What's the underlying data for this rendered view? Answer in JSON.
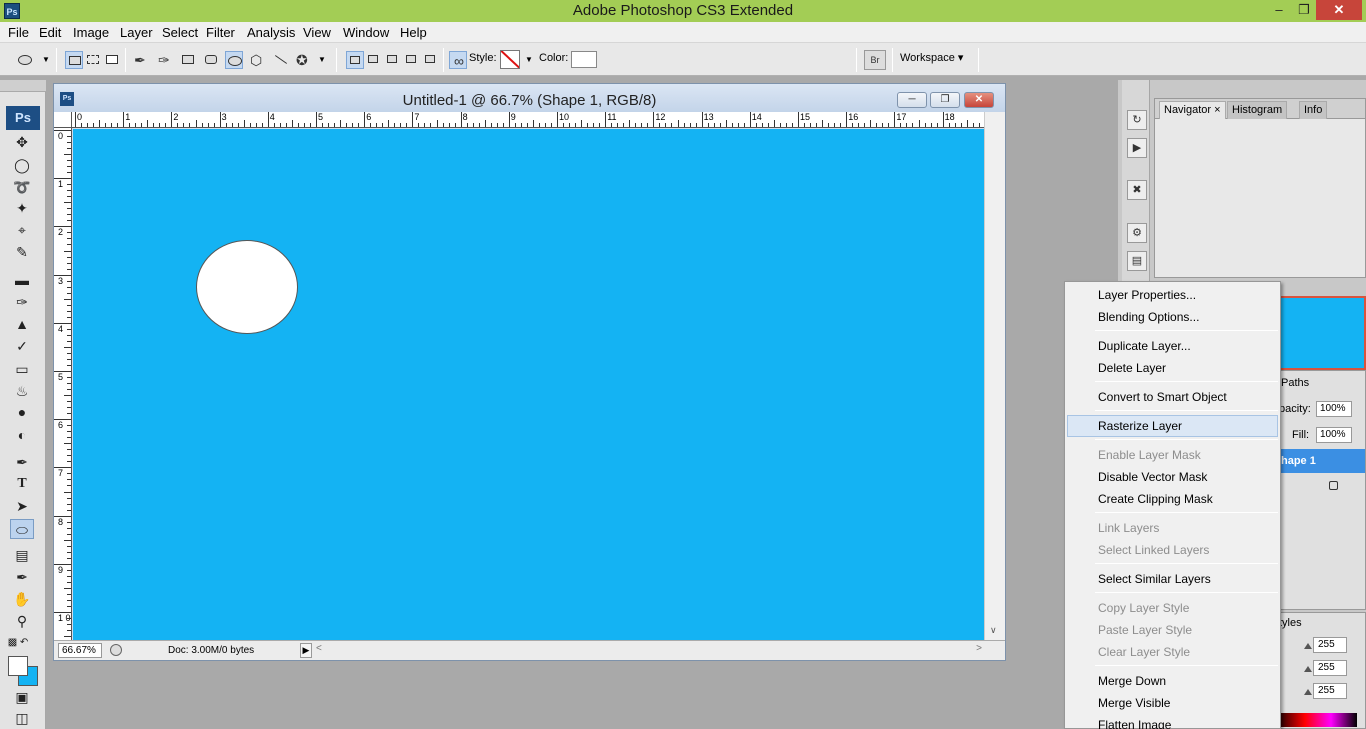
{
  "app": {
    "icon_label": "Ps",
    "title": "Adobe Photoshop CS3 Extended"
  },
  "window_controls": {
    "minimize": "–",
    "maximize": "❐",
    "close": "✕"
  },
  "menubar": [
    "File",
    "Edit",
    "Image",
    "Layer",
    "Select",
    "Filter",
    "Analysis",
    "View",
    "Window",
    "Help"
  ],
  "options": {
    "style_label": "Style:",
    "color_label": "Color:",
    "workspace_label": "Workspace ▾",
    "bridge_icon": "Br"
  },
  "toolbox": {
    "ps_label": "Ps",
    "tools": [
      "move-icon",
      "ellipse-marquee-icon",
      "lasso-icon",
      "magic-wand-icon",
      "crop-icon",
      "slice-icon",
      "healing-brush-icon",
      "brush-icon",
      "clone-stamp-icon",
      "history-brush-icon",
      "eraser-icon",
      "paint-bucket-icon",
      "blur-icon",
      "dodge-icon",
      "pen-icon",
      "type-icon",
      "path-select-icon",
      "ellipse-tool-icon",
      "notes-icon",
      "eyedropper-icon",
      "hand-icon",
      "zoom-icon"
    ],
    "selected_tool": "ellipse-tool-icon",
    "foreground": "#ffffff",
    "background": "#14b3f3"
  },
  "document": {
    "icon_label": "Ps",
    "title": "Untitled-1 @ 66.7% (Shape 1, RGB/8)",
    "ruler_top": [
      "0",
      "1",
      "2",
      "3",
      "4",
      "5",
      "6",
      "7",
      "8",
      "9",
      "10",
      "11",
      "12",
      "13",
      "14",
      "15",
      "16",
      "17",
      "18"
    ],
    "ruler_left": [
      "0",
      "1",
      "2",
      "3",
      "4",
      "5",
      "6",
      "7",
      "8",
      "9",
      "1 0"
    ],
    "canvas_color": "#14b3f3",
    "shape_color": "#ffffff",
    "zoom": "66.67%",
    "doc_info": "Doc: 3.00M/0 bytes"
  },
  "dock": {
    "tabs": [
      "Navigator",
      "Histogram",
      "Info"
    ],
    "paths_tab": "Paths",
    "opacity_label": "pacity:",
    "opacity_value": "100%",
    "fill_label": "Fill:",
    "fill_value": "100%",
    "layer_name": "hape 1",
    "styles_tab": "tyles",
    "rgb_values": [
      "255",
      "255",
      "255"
    ]
  },
  "context_menu": {
    "items": [
      {
        "label": "Layer Properties...",
        "state": "enabled"
      },
      {
        "label": "Blending Options...",
        "state": "enabled"
      },
      {
        "label": "Duplicate Layer...",
        "state": "enabled"
      },
      {
        "label": "Delete Layer",
        "state": "enabled"
      },
      {
        "label": "Convert to Smart Object",
        "state": "enabled"
      },
      {
        "label": "Rasterize Layer",
        "state": "highlighted"
      },
      {
        "label": "Enable Layer Mask",
        "state": "disabled"
      },
      {
        "label": "Disable Vector Mask",
        "state": "enabled"
      },
      {
        "label": "Create Clipping Mask",
        "state": "enabled"
      },
      {
        "label": "Link Layers",
        "state": "disabled"
      },
      {
        "label": "Select Linked Layers",
        "state": "disabled"
      },
      {
        "label": "Select Similar Layers",
        "state": "enabled"
      },
      {
        "label": "Copy Layer Style",
        "state": "disabled"
      },
      {
        "label": "Paste Layer Style",
        "state": "disabled"
      },
      {
        "label": "Clear Layer Style",
        "state": "disabled"
      },
      {
        "label": "Merge Down",
        "state": "enabled"
      },
      {
        "label": "Merge Visible",
        "state": "enabled"
      },
      {
        "label": "Flatten Image",
        "state": "enabled"
      }
    ]
  }
}
